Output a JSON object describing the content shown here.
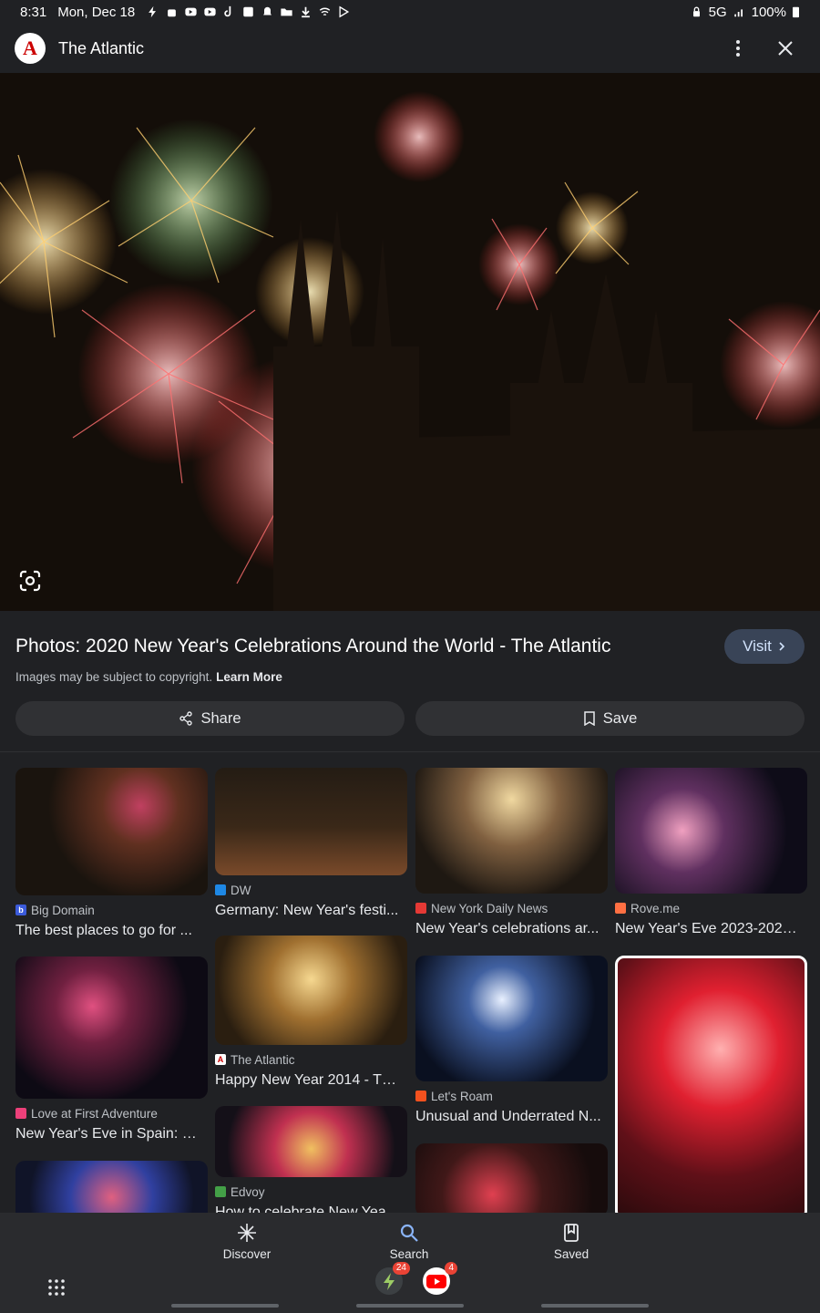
{
  "status_bar": {
    "time": "8:31",
    "date": "Mon, Dec 18",
    "network": "5G",
    "battery": "100%"
  },
  "header": {
    "site_name": "The Atlantic",
    "logo_letter": "A"
  },
  "result": {
    "title": "Photos: 2020 New Year's Celebrations Around the World - The Atlantic",
    "visit_label": "Visit",
    "copyright_text": "Images may be subject to copyright.",
    "learn_more": "Learn More",
    "share_label": "Share",
    "save_label": "Save"
  },
  "related": [
    {
      "source": "Big Domain",
      "title": "The best places to go for ...",
      "fav_color": "#3b5bdb",
      "fav_letter": "b"
    },
    {
      "source": "DW",
      "title": "Germany: New Year's festi...",
      "fav_color": "#1e88e5",
      "fav_letter": ""
    },
    {
      "source": "New York Daily News",
      "title": "New Year's celebrations ar...",
      "fav_color": "#e53935",
      "fav_letter": ""
    },
    {
      "source": "Rove.me",
      "title": "New Year's Eve 2023-2024...",
      "fav_color": "#ff7043",
      "fav_letter": ""
    },
    {
      "source": "Love at First Adventure",
      "title": "New Year's Eve in Spain: G...",
      "fav_color": "#ec407a",
      "fav_letter": ""
    },
    {
      "source": "The Atlantic",
      "title": "Happy New Year 2014 - Th...",
      "fav_color": "#ffffff",
      "fav_letter": "A"
    },
    {
      "source": "Let's Roam",
      "title": "Unusual and Underrated N...",
      "fav_color": "#f4511e",
      "fav_letter": ""
    },
    {
      "source": "Edvoy",
      "title": "How to celebrate New Yea...",
      "fav_color": "#43a047",
      "fav_letter": ""
    }
  ],
  "bottom_nav": {
    "discover": "Discover",
    "search": "Search",
    "saved": "Saved",
    "accent": "#8ab4f8"
  },
  "dock": {
    "badge_1": "24",
    "badge_2": "4"
  }
}
